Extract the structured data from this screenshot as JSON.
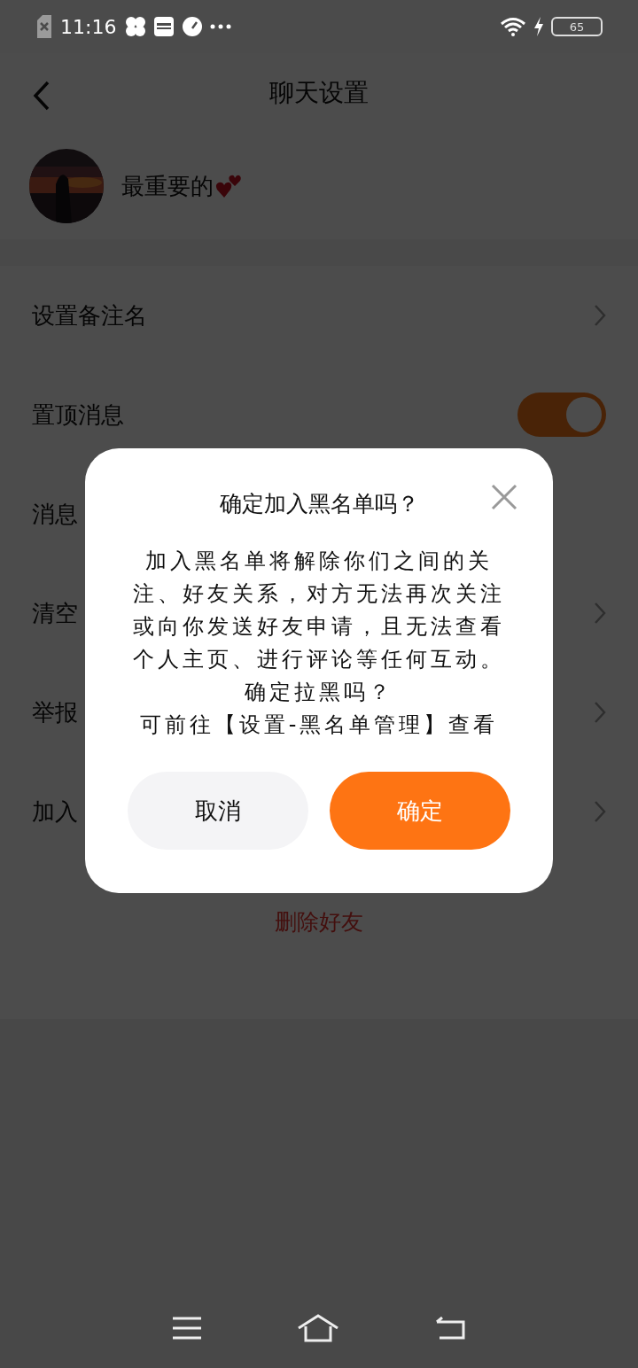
{
  "status_bar": {
    "time": "11:16",
    "battery": "65"
  },
  "header": {
    "title": "聊天设置"
  },
  "profile": {
    "name": "最重要的"
  },
  "settings": [
    {
      "kind": "link",
      "label": "设置备注名"
    },
    {
      "kind": "toggle",
      "label": "置顶消息",
      "on": true
    },
    {
      "kind": "plain",
      "label": "消息"
    },
    {
      "kind": "link",
      "label": "清空"
    },
    {
      "kind": "link",
      "label": "举报"
    },
    {
      "kind": "link",
      "label": "加入"
    }
  ],
  "delete_button": "删除好友",
  "dialog": {
    "title": "确定加入黑名单吗？",
    "message": [
      "加入黑名单将解除你们之间的关注、好友关系，对方无法再次关注或向你发送好友申请，且无法查看个人主页、进行评论等任何互动。",
      "确定拉黑吗？",
      "可前往【设置-黑名单管理】查看"
    ],
    "buttons": [
      {
        "kind": "cancel",
        "label": "取消"
      },
      {
        "kind": "confirm",
        "label": "确定"
      }
    ]
  }
}
